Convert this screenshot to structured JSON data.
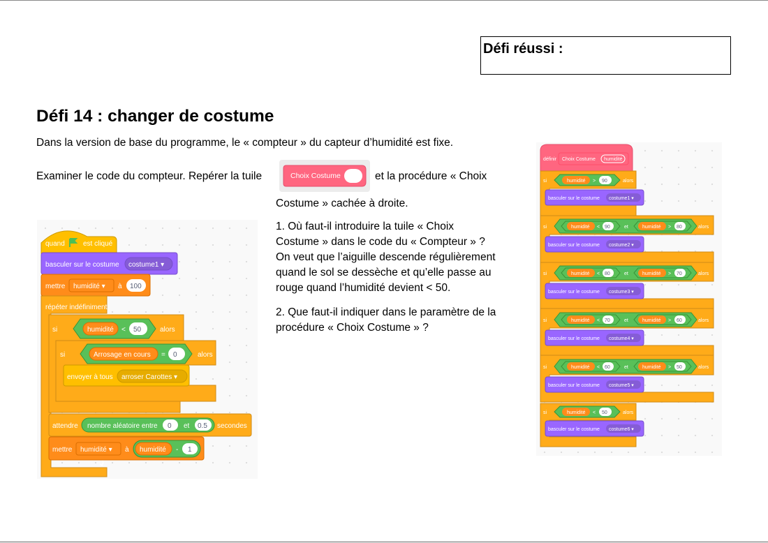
{
  "badge": {
    "label": "Défi réussi :"
  },
  "title": "Défi 14 : changer de costume",
  "intro": "Dans la version de base du programme, le « compteur » du capteur d’humidité est fixe.",
  "examine": {
    "before": "Examiner le code du compteur. Repérer la tuile",
    "after": "et la procédure « Choix",
    "cont": "Costume » cachée à droite.",
    "tile_label": "Choix Costume"
  },
  "q1": [
    "1. Où faut-il introduire la tuile « Choix",
    "Costume » dans le code du « Compteur » ?",
    "On veut que l’aiguille descende régulièrement",
    "quand le sol se dessèche et qu’elle passe au",
    "rouge quand l’humidité devient < 50."
  ],
  "q2": [
    "2. Que faut-il indiquer dans le paramètre de la",
    "procédure « Choix Costume » ?"
  ],
  "left_script": {
    "hat": [
      "quand",
      "est cliqué"
    ],
    "switch": [
      "basculer sur le costume",
      "costume1 ▾"
    ],
    "set1": [
      "mettre",
      "humidité ▾",
      "à",
      "100"
    ],
    "forever": "répéter indéfiniment",
    "if1": [
      "si",
      "humidité",
      "<",
      "50",
      "alors"
    ],
    "if2": [
      "si",
      "Arrosage en cours",
      "=",
      "0",
      "alors"
    ],
    "broadcast": [
      "envoyer à tous",
      "arroser Carottes ▾"
    ],
    "wait": [
      "attendre",
      "nombre aléatoire entre",
      "0",
      "et",
      "0.5",
      "secondes"
    ],
    "set2": [
      "mettre",
      "humidité ▾",
      "à",
      "humidité",
      "-",
      "1"
    ]
  },
  "right_script": {
    "define": [
      "définir",
      "Choix Costume",
      "humidité"
    ],
    "if_a": [
      "si",
      "humidité",
      ">",
      "90",
      "alors"
    ],
    "cos1": [
      "basculer sur le costume",
      "costume1 ▾"
    ],
    "if_b": [
      "si",
      "humidité",
      "<",
      "90",
      "et",
      "humidité",
      ">",
      "80",
      "alors"
    ],
    "cos2": [
      "basculer sur le costume",
      "costume2 ▾"
    ],
    "if_c": [
      "si",
      "humidité",
      "<",
      "80",
      "et",
      "humidité",
      ">",
      "70",
      "alors"
    ],
    "cos3": [
      "basculer sur le costume",
      "costume3 ▾"
    ],
    "if_d": [
      "si",
      "humidité",
      "<",
      "70",
      "et",
      "humidité",
      ">",
      "60",
      "alors"
    ],
    "cos4": [
      "basculer sur le costume",
      "costume4 ▾"
    ],
    "if_e": [
      "si",
      "humidité",
      "<",
      "60",
      "et",
      "humidité",
      ">",
      "50",
      "alors"
    ],
    "cos5": [
      "basculer sur le costume",
      "costume5 ▾"
    ],
    "if_f": [
      "si",
      "humidité",
      "<",
      "50",
      "alors"
    ],
    "cos6": [
      "basculer sur le costume",
      "costume6 ▾"
    ]
  },
  "colors": {
    "control": "#ffab19",
    "control_dark": "#cf8b17",
    "looks": "#9966ff",
    "variables": "#ff8c1a",
    "operators": "#59c059",
    "events": "#ffbf00",
    "myblocks": "#ff6680",
    "flag": "#4cbf56"
  }
}
